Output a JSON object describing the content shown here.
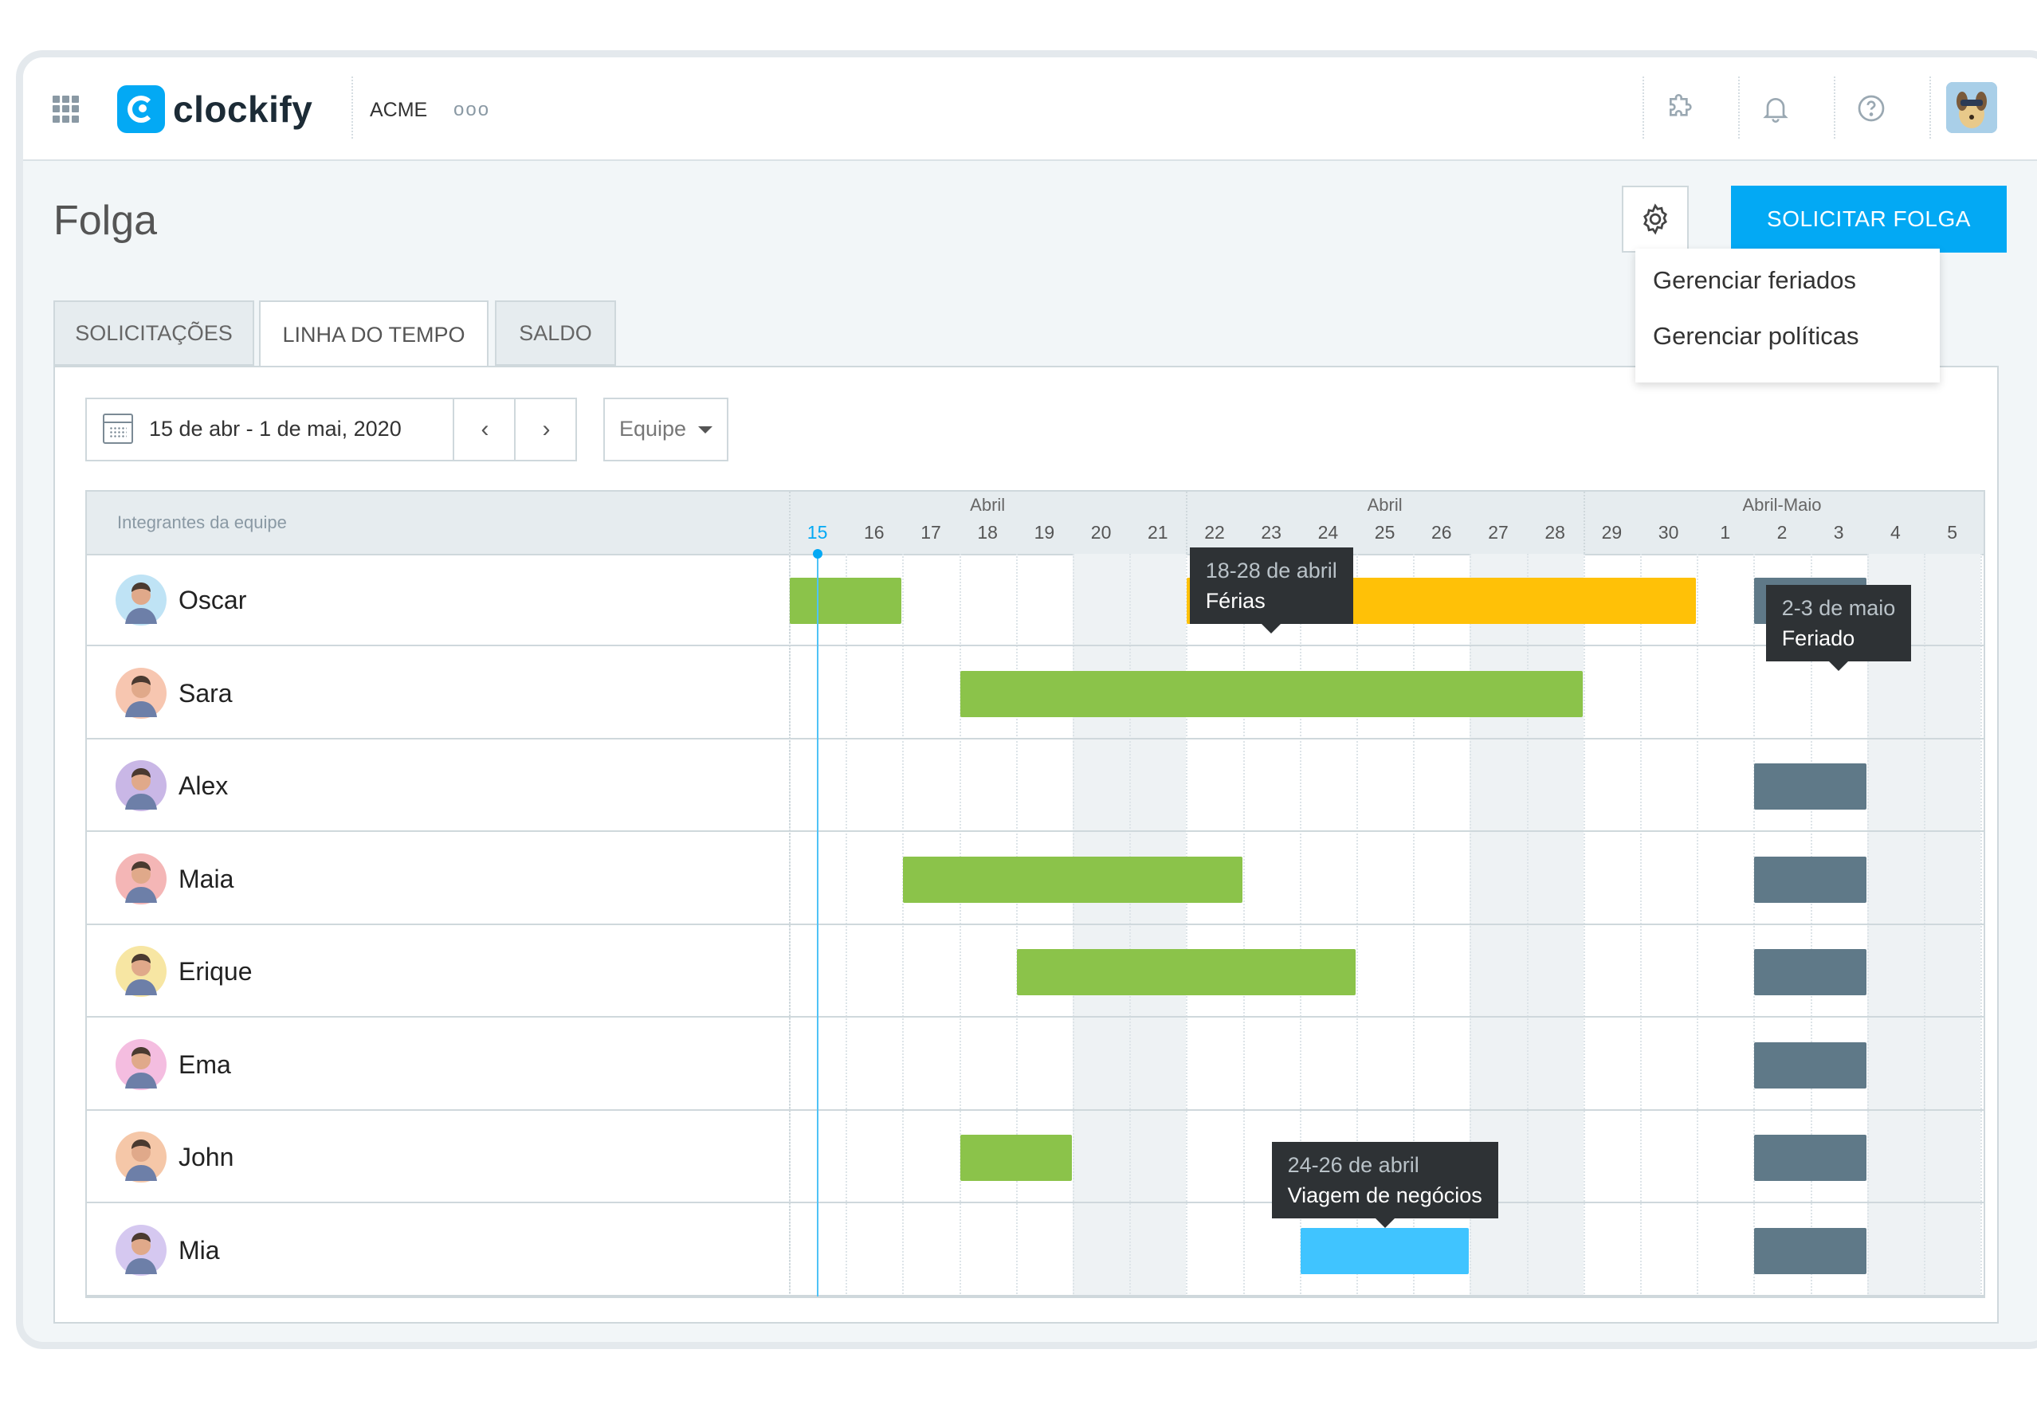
{
  "app": {
    "brand": "clockify",
    "workspace": "ACME",
    "more": "ooo"
  },
  "page": {
    "title": "Folga",
    "primary_button": "SOLICITAR FOLGA"
  },
  "settings_menu": {
    "items": [
      "Gerenciar feriados",
      "Gerenciar políticas"
    ]
  },
  "tabs": [
    {
      "label": "SOLICITAÇÕES",
      "active": false
    },
    {
      "label": "LINHA DO TEMPO",
      "active": true
    },
    {
      "label": "SALDO",
      "active": false
    }
  ],
  "filters": {
    "date_range": "15 de abr - 1 de mai, 2020",
    "team_select": "Equipe"
  },
  "timeline": {
    "members_header": "Integrantes da equipe",
    "month_labels": [
      "Abril",
      "Abril",
      "Abril-Maio"
    ],
    "days": [
      "15",
      "16",
      "17",
      "18",
      "19",
      "20",
      "21",
      "22",
      "23",
      "24",
      "25",
      "26",
      "27",
      "28",
      "29",
      "30",
      "1",
      "2",
      "3",
      "4",
      "5"
    ],
    "today": "15",
    "weekend_columns": [
      5,
      6,
      12,
      13,
      19,
      20
    ],
    "members": [
      {
        "name": "Oscar",
        "avatar_color": "#bfe3f5",
        "bars": [
          {
            "start": 0,
            "end": 2,
            "kind": "vacation"
          },
          {
            "start": 7,
            "end": 16,
            "kind": "pending"
          },
          {
            "start": 17,
            "end": 19,
            "kind": "holiday"
          }
        ]
      },
      {
        "name": "Sara",
        "avatar_color": "#f7c6b0",
        "bars": [
          {
            "start": 3,
            "end": 14,
            "kind": "vacation"
          }
        ]
      },
      {
        "name": "Alex",
        "avatar_color": "#c9b7e6",
        "bars": [
          {
            "start": 17,
            "end": 19,
            "kind": "holiday"
          }
        ]
      },
      {
        "name": "Maia",
        "avatar_color": "#f4b6b6",
        "bars": [
          {
            "start": 2,
            "end": 8,
            "kind": "vacation"
          },
          {
            "start": 17,
            "end": 19,
            "kind": "holiday"
          }
        ]
      },
      {
        "name": "Erique",
        "avatar_color": "#f7e6a3",
        "bars": [
          {
            "start": 4,
            "end": 10,
            "kind": "vacation"
          },
          {
            "start": 17,
            "end": 19,
            "kind": "holiday"
          }
        ]
      },
      {
        "name": "Ema",
        "avatar_color": "#f4bde0",
        "bars": [
          {
            "start": 17,
            "end": 19,
            "kind": "holiday"
          }
        ]
      },
      {
        "name": "John",
        "avatar_color": "#f5c7a8",
        "bars": [
          {
            "start": 3,
            "end": 5,
            "kind": "vacation"
          },
          {
            "start": 17,
            "end": 19,
            "kind": "holiday"
          }
        ]
      },
      {
        "name": "Mia",
        "avatar_color": "#d5c8f0",
        "bars": [
          {
            "start": 9,
            "end": 12,
            "kind": "business"
          },
          {
            "start": 17,
            "end": 19,
            "kind": "holiday"
          }
        ]
      }
    ],
    "colors": {
      "vacation": "#8bc34a",
      "pending": "#ffc107",
      "holiday": "#5f7988",
      "business": "#40c4ff",
      "today_line": "#4fc3f7"
    },
    "tooltips": [
      {
        "dates": "18-28 de abril",
        "label": "Férias",
        "row": 0,
        "day": 8
      },
      {
        "dates": "2-3 de maio",
        "label": "Feriado",
        "row": 1,
        "day": 18
      },
      {
        "dates": "24-26 de abril",
        "label": "Viagem de negócios",
        "row": 7,
        "day": 10
      }
    ]
  },
  "icons": {
    "apps": "apps-grid-icon",
    "integrations": "puzzle-icon",
    "notifications": "bell-icon",
    "help": "help-icon",
    "settings": "gear-icon",
    "calendar": "calendar-icon",
    "prev": "chevron-left-icon",
    "next": "chevron-right-icon",
    "dropdown": "caret-down-icon"
  }
}
